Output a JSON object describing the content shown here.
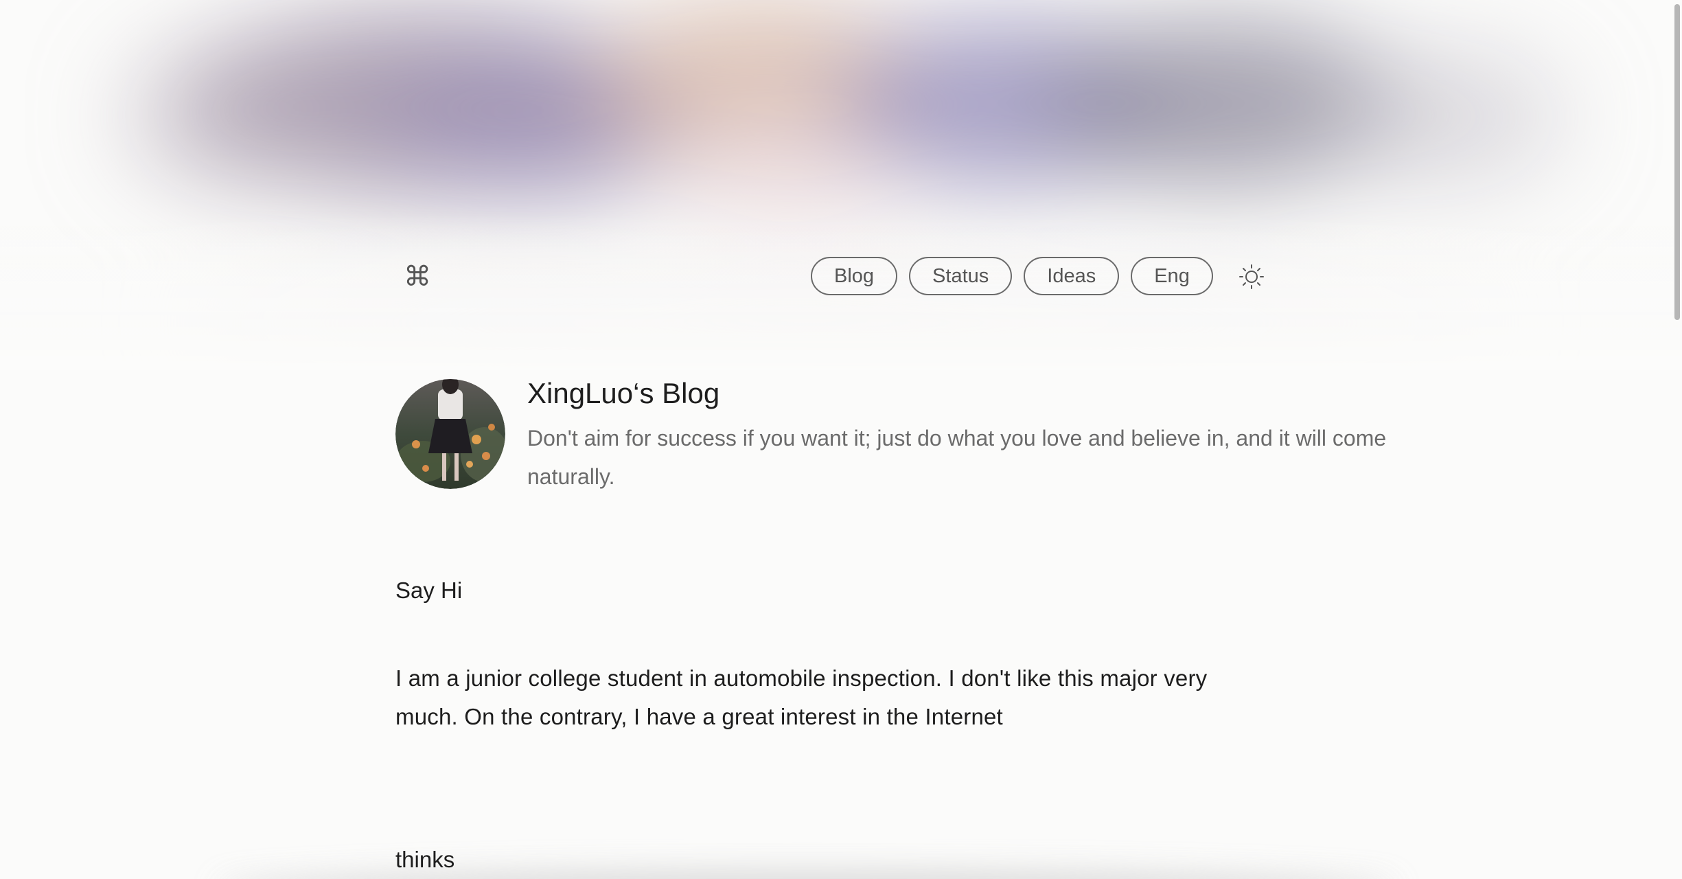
{
  "nav": {
    "logo_icon": "command-icon",
    "links": [
      {
        "label": "Blog"
      },
      {
        "label": "Status"
      },
      {
        "label": "Ideas"
      },
      {
        "label": "Eng"
      }
    ],
    "theme_icon": "sun-icon"
  },
  "profile": {
    "title": "XingLuo‘s Blog",
    "motto": "Don't aim for success if you want it; just do what you love and believe in, and it will come naturally."
  },
  "sections": {
    "say_hi": {
      "heading": "Say Hi",
      "body": "I am a junior college student in automobile inspection. I don't like this major very much. On the contrary, I have a great interest in the Internet"
    },
    "thinks": {
      "heading": "thinks"
    }
  },
  "colors": {
    "background": "#fbfbfa",
    "text": "#1d1d1d",
    "muted_text": "#6b6b6b",
    "pill_border": "#6a6a6a"
  }
}
